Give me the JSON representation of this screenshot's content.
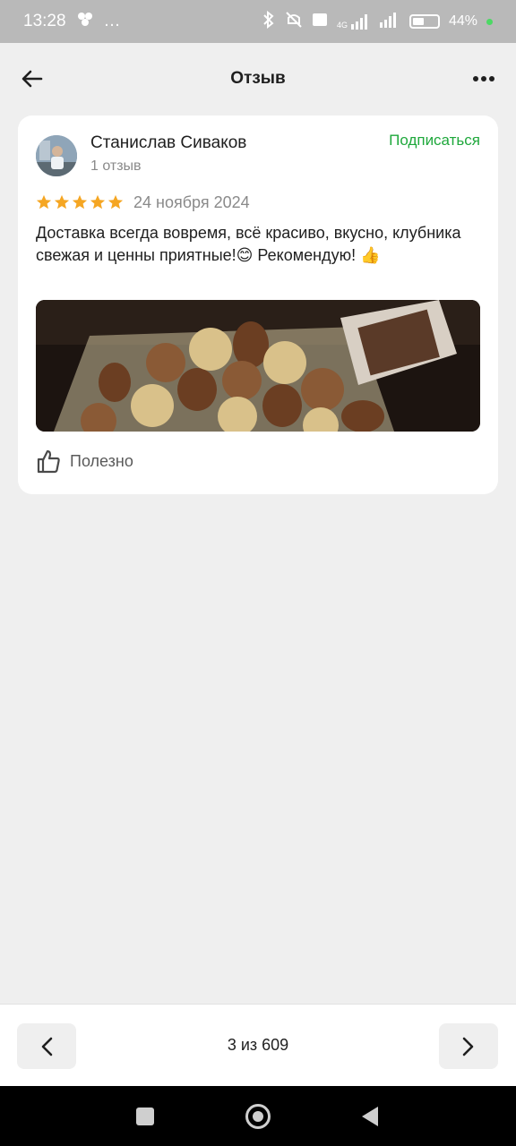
{
  "status_bar": {
    "time": "13:28",
    "extra": "…",
    "signal_label": "4G",
    "battery_percent": "44%",
    "icons": [
      "bluetooth-icon",
      "mute-icon",
      "volte-icon",
      "signal-icon",
      "battery-icon"
    ]
  },
  "header": {
    "title": "Отзыв",
    "back_icon": "arrow-left-icon",
    "menu_icon": "more-horizontal-icon"
  },
  "review": {
    "author_name": "Станислав Сиваков",
    "review_count": "1 отзыв",
    "subscribe_label": "Подписаться",
    "rating": 5,
    "date": "24 ноября 2024",
    "text": "Доставка всегда вовремя, всё красиво, вкусно, клубника свежая и ценны приятные!😊 Рекомендую! 👍",
    "helpful_label": "Полезно"
  },
  "pager": {
    "text": "3 из 609",
    "prev_icon": "chevron-left-icon",
    "next_icon": "chevron-right-icon"
  },
  "colors": {
    "accent_green": "#1fa83c",
    "star_yellow": "#f5a623",
    "background": "#efefef"
  }
}
